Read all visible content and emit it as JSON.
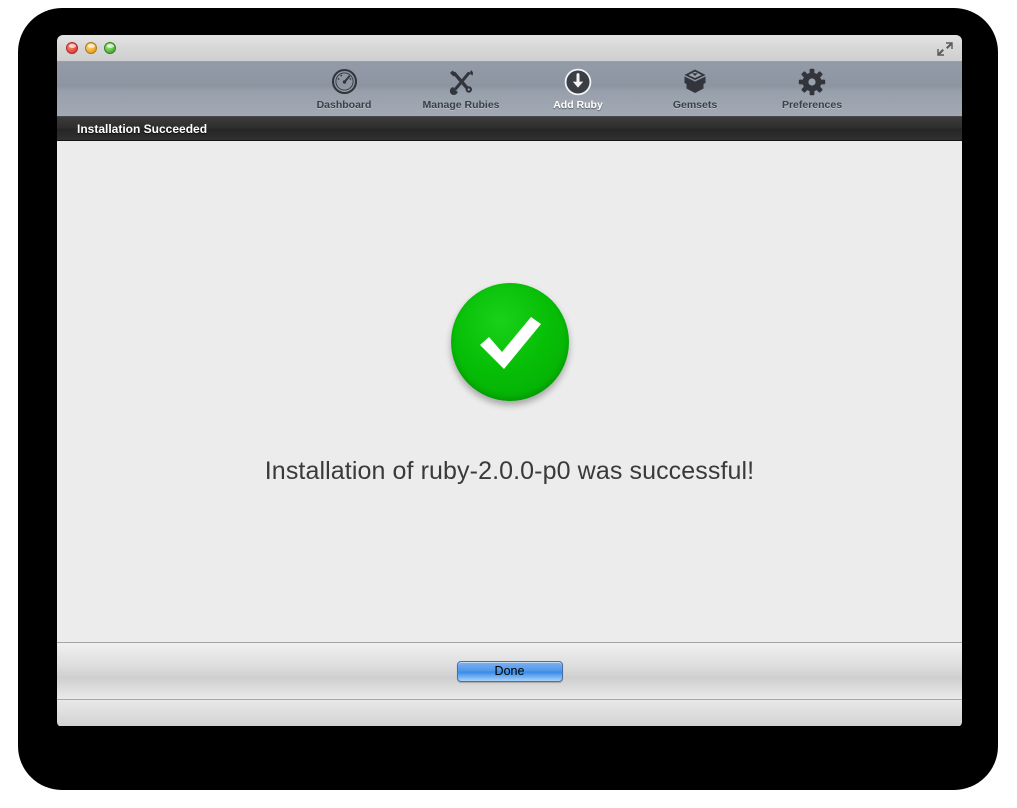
{
  "window": {
    "traffic_lights": [
      {
        "name": "close",
        "color": "#e0443a"
      },
      {
        "name": "minimize",
        "color": "#e9a423"
      },
      {
        "name": "zoom",
        "color": "#4fb03a"
      }
    ],
    "fullscreen_icon": "fullscreen-expand-icon"
  },
  "toolbar": {
    "items": [
      {
        "label": "Dashboard",
        "icon": "gauge-icon",
        "selected": false
      },
      {
        "label": "Manage Rubies",
        "icon": "wrench-screwdriver-icon",
        "selected": false
      },
      {
        "label": "Add Ruby",
        "icon": "download-circle-icon",
        "selected": true
      },
      {
        "label": "Gemsets",
        "icon": "gem-box-icon",
        "selected": false
      },
      {
        "label": "Preferences",
        "icon": "gear-icon",
        "selected": false
      }
    ],
    "selected_label_color": "#ffffff",
    "label_color": "#3b3f46"
  },
  "section_header": {
    "title": "Installation Succeeded"
  },
  "main": {
    "status_icon": "green-check-circle-icon",
    "status_color": "#07bf07",
    "message": "Installation of ruby-2.0.0-p0 was successful!"
  },
  "button_bar": {
    "done_label": "Done",
    "done_accent": "#4f96ec"
  }
}
